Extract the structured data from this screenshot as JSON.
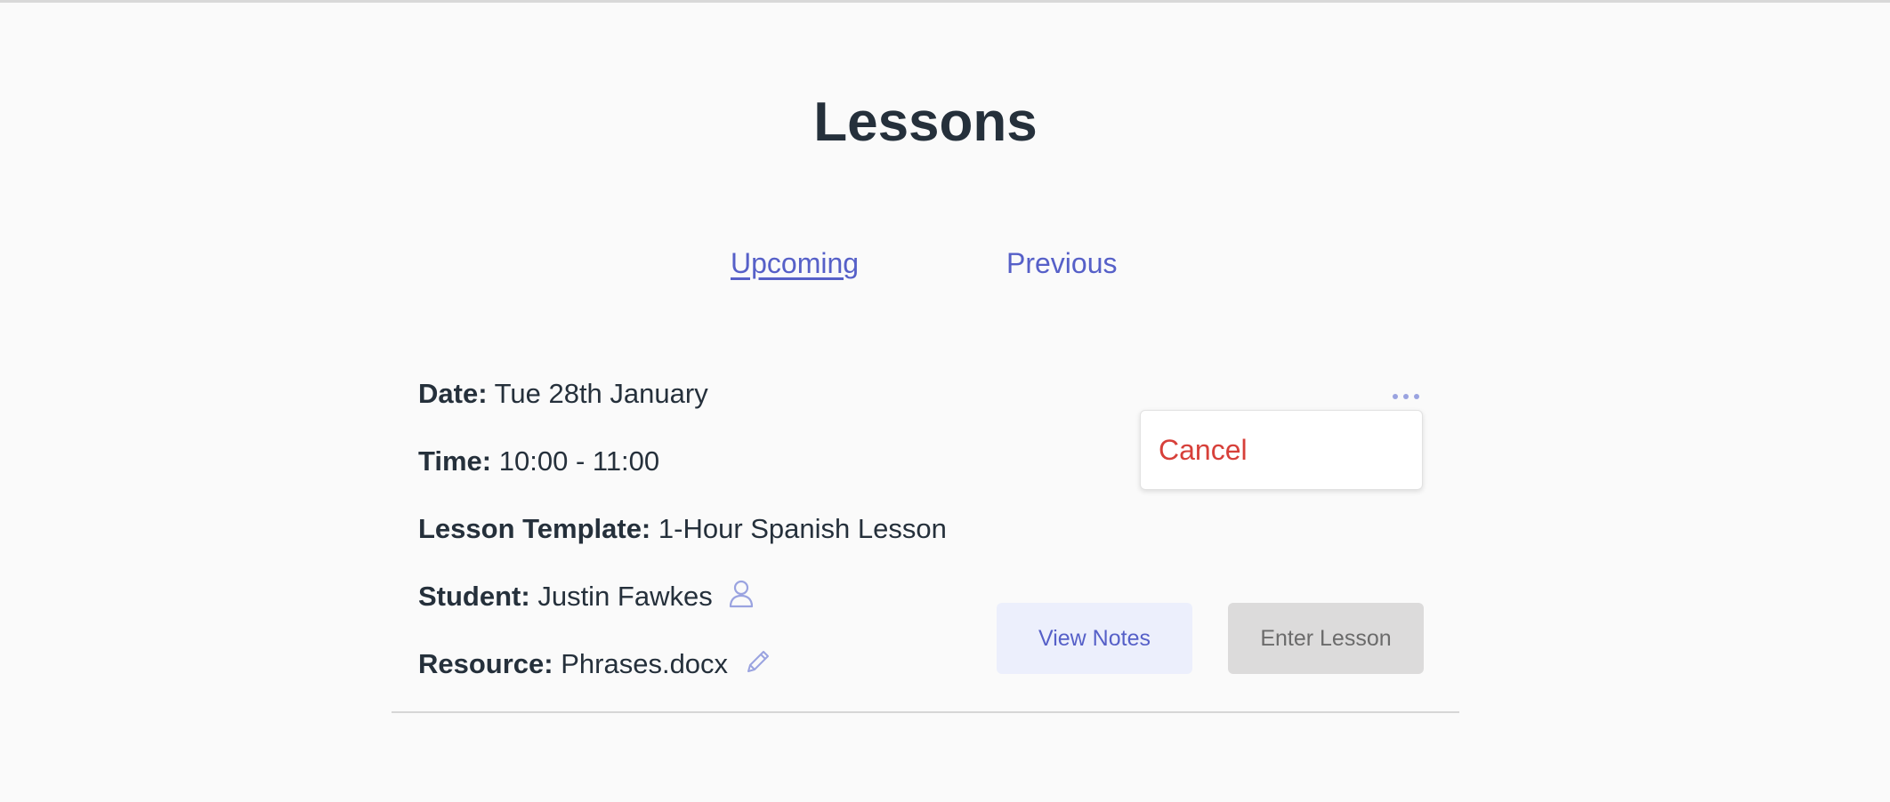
{
  "page": {
    "title": "Lessons"
  },
  "tabs": [
    {
      "label": "Upcoming",
      "active": true
    },
    {
      "label": "Previous",
      "active": false
    }
  ],
  "lesson": {
    "date_label": "Date:",
    "date_value": "Tue 28th January",
    "time_label": "Time:",
    "time_value": "10:00 - 11:00",
    "template_label": "Lesson Template:",
    "template_value": "1-Hour Spanish Lesson",
    "student_label": "Student:",
    "student_value": "Justin Fawkes",
    "student_icon": "user-icon",
    "resource_label": "Resource:",
    "resource_value": "Phrases.docx",
    "resource_icon": "pencil-icon",
    "more_icon": "more-horizontal-icon",
    "menu": {
      "cancel_label": "Cancel"
    },
    "buttons": {
      "view_notes_label": "View Notes",
      "enter_lesson_label": "Enter Lesson"
    }
  },
  "colors": {
    "accent": "#5660c8",
    "danger": "#d7403a",
    "text": "#25303b",
    "background": "#fafafa"
  }
}
